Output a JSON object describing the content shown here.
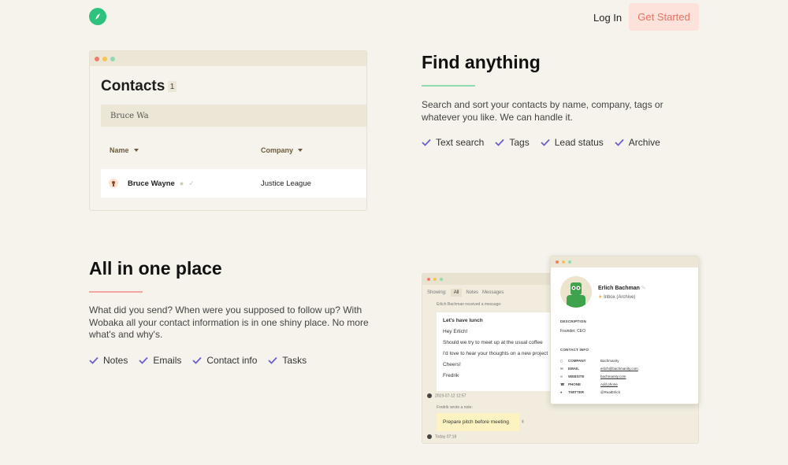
{
  "header": {
    "logo_icon": "compass-icon",
    "login_label": "Log In",
    "get_started_label": "Get Started"
  },
  "contacts_window": {
    "title": "Contacts",
    "count": "1",
    "search_value": "Bruce Wa",
    "columns": [
      "Name",
      "Company"
    ],
    "rows": [
      {
        "name": "Bruce Wayne",
        "company": "Justice League"
      }
    ]
  },
  "find_anything": {
    "title": "Find anything",
    "description": "Search and sort your contacts by name, company, tags or whatever you like. We can handle it.",
    "features": [
      "Text search",
      "Tags",
      "Lead status",
      "Archive"
    ],
    "accent_color": "#8edbb0"
  },
  "all_in_one": {
    "title": "All in one place",
    "description": "What did you send? When were you supposed to follow up? With Wobaka all your contact information is in one shiny place. No more what's and why's.",
    "features": [
      "Notes",
      "Emails",
      "Contact info",
      "Tasks"
    ],
    "accent_color": "#f3a7a0"
  },
  "messages_window": {
    "showing_label": "Showing:",
    "tabs": [
      "All",
      "Notes",
      "Messages"
    ],
    "received_meta": "Erlich Bachman received a message:",
    "message": {
      "subject": "Let's have lunch",
      "greeting": "Hey Erlich!",
      "line1": "Should we try to meet up at the usual coffee",
      "line2": "I'd love to hear your thoughts on a new project",
      "closing": "Cheers!",
      "signature": "Fredrik"
    },
    "message_date": "2019-07-12 12:57",
    "note_meta": "Fredrik wrote a note:",
    "note_text": "Prepare pitch before meeting",
    "note_date": "Today 07:18"
  },
  "profile_window": {
    "name": "Erlich Bachman",
    "inbox_label": "Inbox",
    "archive_label": "(Archive)",
    "description_label": "DESCRIPTION",
    "description_value": "Founder, CEO",
    "contact_info_label": "CONTACT INFO",
    "info": [
      {
        "icon": "building-icon",
        "label": "COMPANY",
        "value": "Bachmanity"
      },
      {
        "icon": "mail-icon",
        "label": "EMAIL",
        "value": "erlich@bachmanity.com"
      },
      {
        "icon": "link-icon",
        "label": "WEBSITE",
        "value": "bachmanity.com"
      },
      {
        "icon": "phone-icon",
        "label": "PHONE",
        "value": "Add phone"
      },
      {
        "icon": "twitter-icon",
        "label": "TWITTER",
        "value": "@RealErlich"
      }
    ]
  }
}
